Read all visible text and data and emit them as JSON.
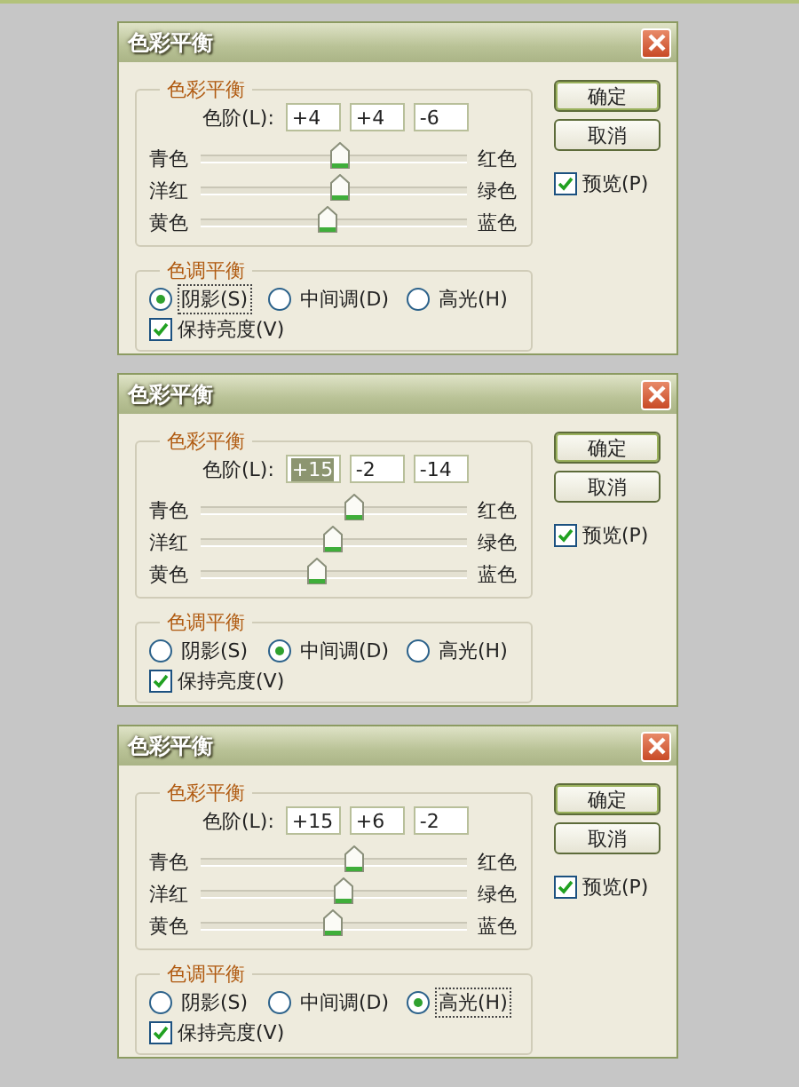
{
  "dialogs": [
    {
      "title": "色彩平衡",
      "color_balance": {
        "legend": "色彩平衡",
        "levels_label": "色阶(L):",
        "fields": [
          {
            "value": "+4",
            "selected": false
          },
          {
            "value": "+4",
            "selected": false
          },
          {
            "value": "-6",
            "selected": false
          }
        ],
        "sliders": [
          {
            "left": "青色",
            "right": "红色",
            "level": 0.52
          },
          {
            "left": "洋红",
            "right": "绿色",
            "level": 0.52
          },
          {
            "left": "黄色",
            "right": "蓝色",
            "level": 0.47
          }
        ]
      },
      "tone_balance": {
        "legend": "色调平衡",
        "options": [
          {
            "label": "阴影(S)",
            "selected": true,
            "focused": true
          },
          {
            "label": "中间调(D)",
            "selected": false,
            "focused": false
          },
          {
            "label": "高光(H)",
            "selected": false,
            "focused": false
          }
        ],
        "preserve_luminosity": {
          "label": "保持亮度(V)",
          "checked": true
        }
      },
      "buttons": [
        "确定",
        "取消"
      ],
      "preview": {
        "label": "预览(P)",
        "checked": true
      }
    },
    {
      "title": "色彩平衡",
      "color_balance": {
        "legend": "色彩平衡",
        "levels_label": "色阶(L):",
        "fields": [
          {
            "value": "+15",
            "selected": true
          },
          {
            "value": "-2",
            "selected": false
          },
          {
            "value": "-14",
            "selected": false
          }
        ],
        "sliders": [
          {
            "left": "青色",
            "right": "红色",
            "level": 0.575
          },
          {
            "left": "洋红",
            "right": "绿色",
            "level": 0.49
          },
          {
            "left": "黄色",
            "right": "蓝色",
            "level": 0.43
          }
        ]
      },
      "tone_balance": {
        "legend": "色调平衡",
        "options": [
          {
            "label": "阴影(S)",
            "selected": false,
            "focused": false
          },
          {
            "label": "中间调(D)",
            "selected": true,
            "focused": false
          },
          {
            "label": "高光(H)",
            "selected": false,
            "focused": false
          }
        ],
        "preserve_luminosity": {
          "label": "保持亮度(V)",
          "checked": true
        }
      },
      "buttons": [
        "确定",
        "取消"
      ],
      "preview": {
        "label": "预览(P)",
        "checked": true
      }
    },
    {
      "title": "色彩平衡",
      "color_balance": {
        "legend": "色彩平衡",
        "levels_label": "色阶(L):",
        "fields": [
          {
            "value": "+15",
            "selected": false
          },
          {
            "value": "+6",
            "selected": false
          },
          {
            "value": "-2",
            "selected": false
          }
        ],
        "sliders": [
          {
            "left": "青色",
            "right": "红色",
            "level": 0.575
          },
          {
            "left": "洋红",
            "right": "绿色",
            "level": 0.53
          },
          {
            "left": "黄色",
            "right": "蓝色",
            "level": 0.49
          }
        ]
      },
      "tone_balance": {
        "legend": "色调平衡",
        "options": [
          {
            "label": "阴影(S)",
            "selected": false,
            "focused": false
          },
          {
            "label": "中间调(D)",
            "selected": false,
            "focused": false
          },
          {
            "label": "高光(H)",
            "selected": true,
            "focused": true
          }
        ],
        "preserve_luminosity": {
          "label": "保持亮度(V)",
          "checked": true
        }
      },
      "buttons": [
        "确定",
        "取消"
      ],
      "preview": {
        "label": "预览(P)",
        "checked": true
      }
    }
  ]
}
